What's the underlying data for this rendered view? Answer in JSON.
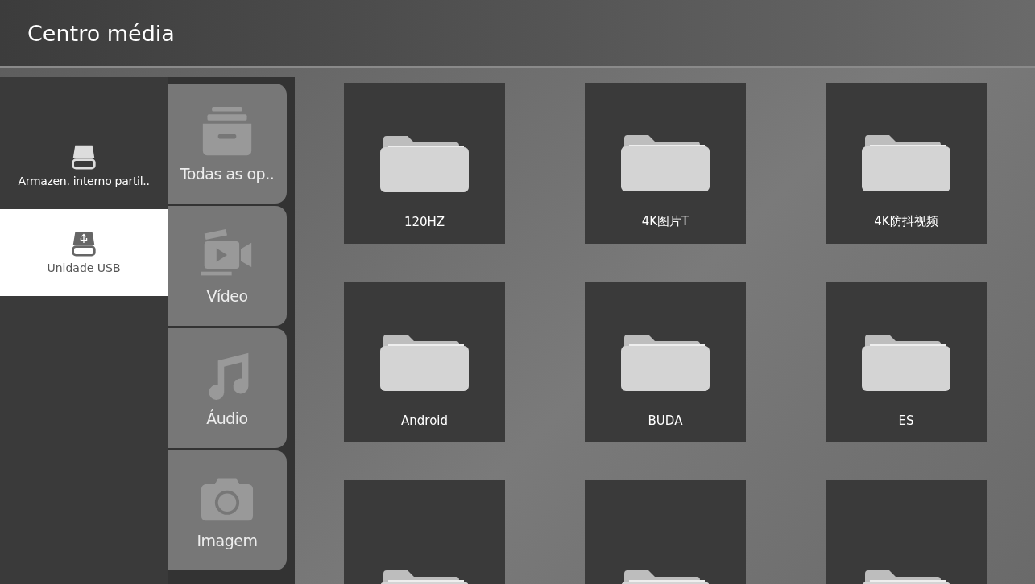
{
  "window": {
    "title": "Centro média"
  },
  "storage": [
    {
      "label": "Armazen. interno partil..",
      "kind": "internal",
      "selected": false
    },
    {
      "label": "Unidade USB",
      "kind": "usb",
      "selected": true
    }
  ],
  "categories": [
    {
      "label": "Todas as op..",
      "kind": "all"
    },
    {
      "label": "Vídeo",
      "kind": "video"
    },
    {
      "label": "Áudio",
      "kind": "audio"
    },
    {
      "label": "Imagem",
      "kind": "image"
    }
  ],
  "folders": [
    {
      "kind": "folder",
      "name": "120HZ"
    },
    {
      "kind": "folder",
      "name": "4K图片T"
    },
    {
      "kind": "folder",
      "name": "4K防抖视频"
    },
    {
      "kind": "folder",
      "name": "Android"
    },
    {
      "kind": "folder",
      "name": "BUDA"
    },
    {
      "kind": "folder",
      "name": "ES"
    },
    {
      "kind": "folder"
    },
    {
      "kind": "folder"
    },
    {
      "kind": "folder"
    }
  ]
}
